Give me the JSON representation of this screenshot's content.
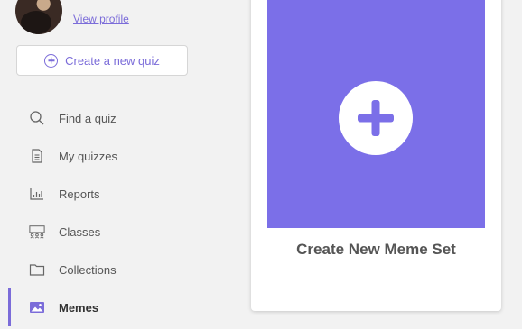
{
  "profile": {
    "view_profile_label": "View profile"
  },
  "create_quiz": {
    "label": "Create a new quiz",
    "icon": "plus-circle-icon"
  },
  "nav": {
    "items": [
      {
        "label": "Find a quiz",
        "icon": "search-icon",
        "active": false
      },
      {
        "label": "My quizzes",
        "icon": "document-icon",
        "active": false
      },
      {
        "label": "Reports",
        "icon": "bar-chart-icon",
        "active": false
      },
      {
        "label": "Classes",
        "icon": "people-icon",
        "active": false
      },
      {
        "label": "Collections",
        "icon": "folder-icon",
        "active": false
      },
      {
        "label": "Memes",
        "icon": "image-icon",
        "active": true
      }
    ]
  },
  "card": {
    "title": "Create New Meme Set",
    "icon": "add-icon"
  },
  "colors": {
    "accent": "#7b6cd9",
    "card_fill": "#7b6fe8",
    "background": "#f2f2f2"
  }
}
